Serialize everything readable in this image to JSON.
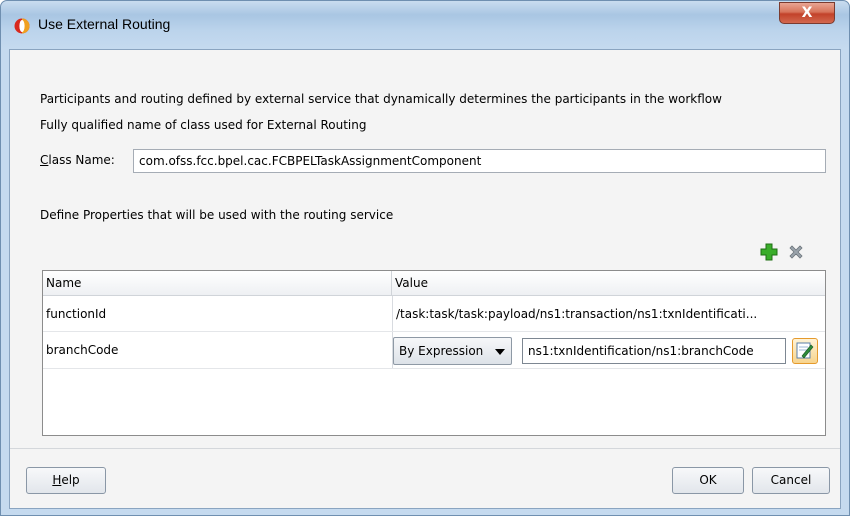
{
  "window": {
    "title": "Use External Routing",
    "close_glyph": "X",
    "icon": "oracle-icon"
  },
  "intro": {
    "line1": "Participants and routing defined by external service that dynamically determines the participants in the workflow",
    "line2": "Fully qualified name of class used for External Routing"
  },
  "class_name": {
    "label": "Class Name:",
    "value": "com.ofss.fcc.bpel.cac.FCBPELTaskAssignmentComponent"
  },
  "properties": {
    "heading": "Define Properties that will be used with the routing service",
    "add_icon": "plus-icon",
    "remove_icon": "delete-x-icon",
    "columns": [
      "Name",
      "Value"
    ],
    "rows": [
      {
        "name": "functionId",
        "value": "/task:task/task:payload/ns1:transaction/ns1:txnIdentificati..."
      },
      {
        "name": "branchCode",
        "mode": "By Expression",
        "value": "ns1:txnIdentification/ns1:branchCode"
      }
    ],
    "edit_icon": "edit-expression-icon"
  },
  "buttons": {
    "help": "Help",
    "ok": "OK",
    "cancel": "Cancel"
  },
  "colors": {
    "titlebar": "#bcd4ec",
    "close": "#c2422a",
    "add": "#2e9a1e"
  }
}
